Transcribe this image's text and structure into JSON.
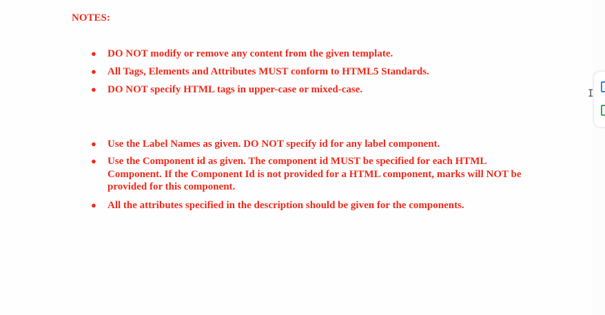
{
  "heading": "NOTES:",
  "bullet_glyph": "●",
  "group1": [
    "DO NOT modify or remove any content from the given template.",
    "All Tags, Elements and Attributes MUST conform to HTML5 Standards.",
    "DO NOT specify HTML tags in upper-case or mixed-case."
  ],
  "group2": [
    "Use the Label Names as given. DO NOT specify id for any label component.",
    "Use the Component id as given. The component id MUST be specified for each HTML Component. If the Component Id is not provided for a HTML component, marks will NOT be provided for this component.",
    "All the attributes specified in the description should be given for the components."
  ],
  "colors": {
    "text": "#ee2a1c"
  },
  "cursor_glyph": "I"
}
